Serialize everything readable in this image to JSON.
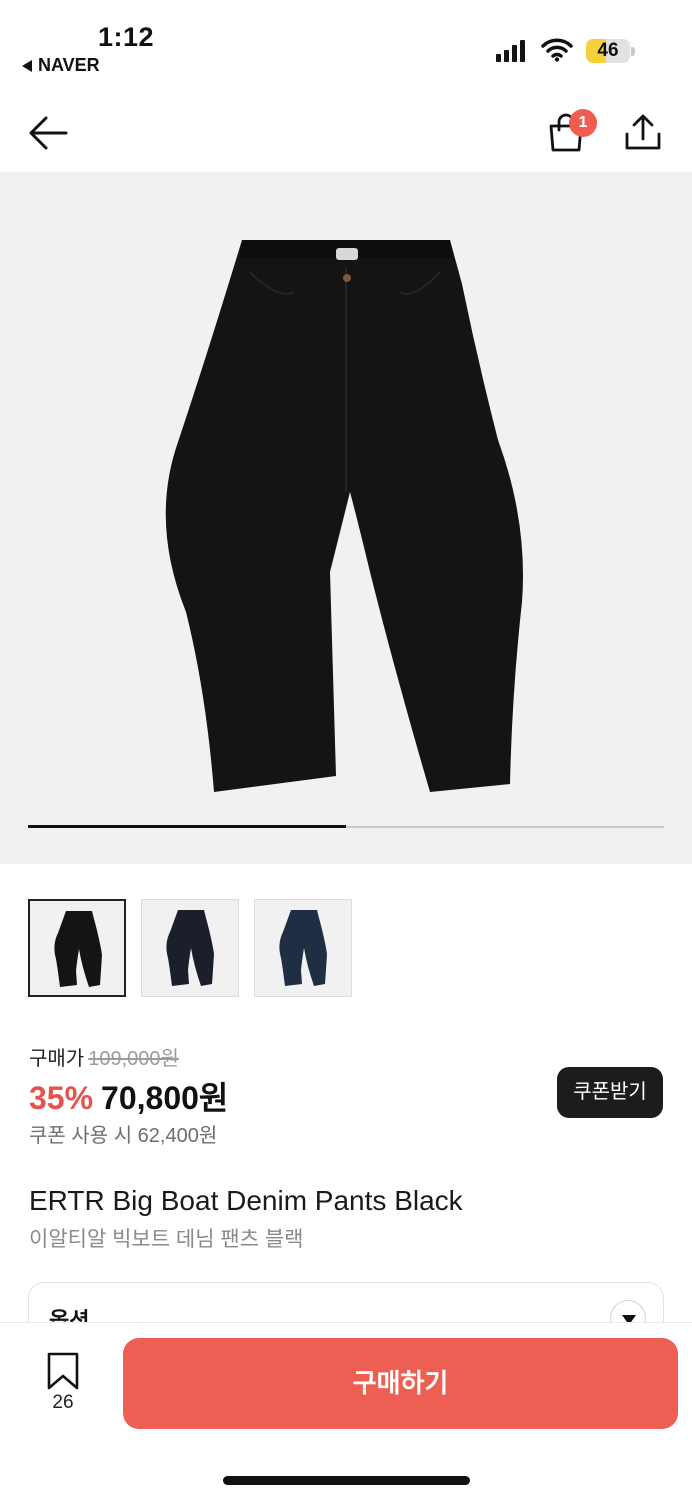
{
  "status_bar": {
    "time": "1:12",
    "back_app": "NAVER",
    "battery": "46",
    "battery_level": 0.46
  },
  "header": {
    "back_icon": "arrow-left-icon",
    "cart_icon": "shopping-bag-icon",
    "cart_badge": "1",
    "share_icon": "share-upload-icon"
  },
  "gallery": {
    "image_progress": 0.5,
    "thumbnails": [
      {
        "color": "#141414",
        "selected": true
      },
      {
        "color": "#1b1f2b",
        "selected": false
      },
      {
        "color": "#1f2e42",
        "selected": false
      }
    ]
  },
  "price": {
    "label": "구매가",
    "original": "109,000원",
    "discount": "35%",
    "sale": "70,800원",
    "coupon_price": "쿠폰 사용 시 62,400원",
    "coupon_button": "쿠폰받기"
  },
  "product": {
    "name_en": "ERTR Big Boat Denim Pants Black",
    "name_kr": "이알티알 빅보트 데님 팬츠 블랙"
  },
  "option": {
    "label": "옵션"
  },
  "bottom": {
    "bookmark_count": "26",
    "buy_button": "구매하기"
  },
  "colors": {
    "accent": "#ee5f53",
    "discount": "#e5534b",
    "dark_button": "#1c1c1c"
  }
}
